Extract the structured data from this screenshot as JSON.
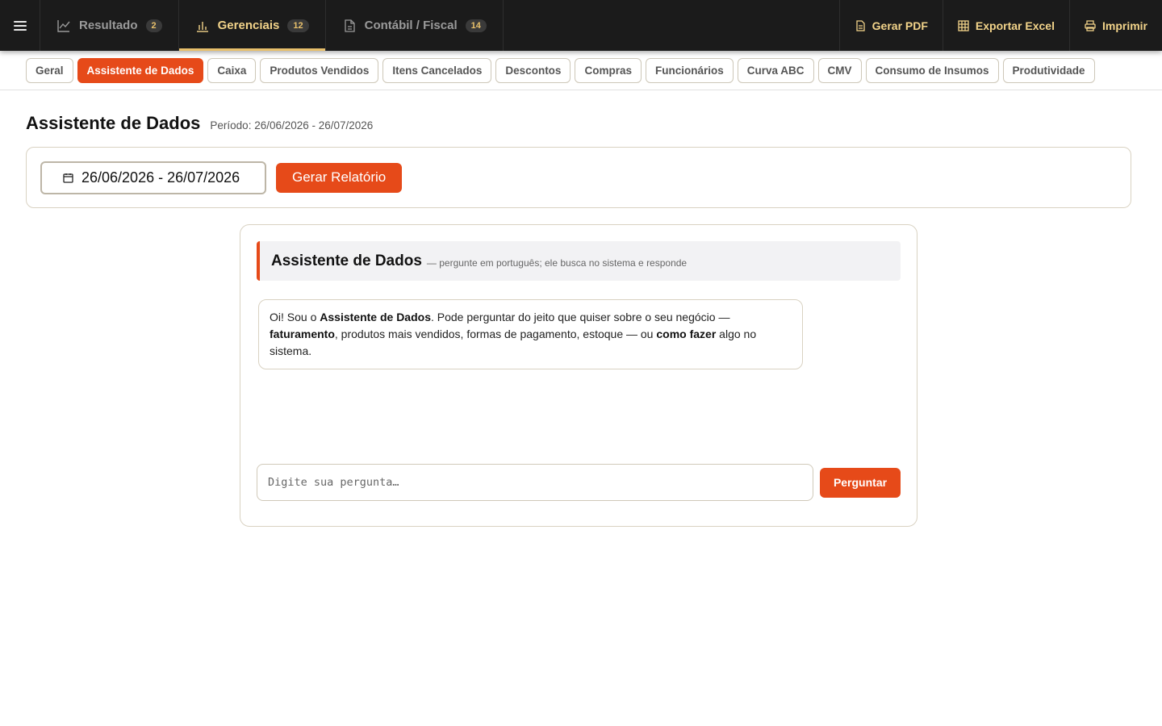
{
  "topbar": {
    "tabs": [
      {
        "label": "Resultado",
        "badge": "2"
      },
      {
        "label": "Gerenciais",
        "badge": "12"
      },
      {
        "label": "Contábil / Fiscal",
        "badge": "14"
      }
    ],
    "active_tab": "Gerenciais",
    "actions": {
      "pdf": "Gerar PDF",
      "excel": "Exportar Excel",
      "print": "Imprimir"
    }
  },
  "subtabs": [
    "Geral",
    "Assistente de Dados",
    "Caixa",
    "Produtos Vendidos",
    "Itens Cancelados",
    "Descontos",
    "Compras",
    "Funcionários",
    "Curva ABC",
    "CMV",
    "Consumo de Insumos",
    "Produtividade"
  ],
  "active_subtab": "Assistente de Dados",
  "page": {
    "title": "Assistente de Dados",
    "period": "Período: 26/06/2026 - 26/07/2026"
  },
  "filter": {
    "date_range": "26/06/2026 - 26/07/2026",
    "generate_label": "Gerar Relatório"
  },
  "assistant": {
    "title": "Assistente de Dados",
    "subtitle": "— pergunte em português; ele busca no sistema e responde",
    "greeting": {
      "p1": "Oi! Sou o ",
      "b1": "Assistente de Dados",
      "p2": ". Pode perguntar do jeito que quiser sobre o seu negócio — ",
      "b2": "faturamento",
      "p3": ", produtos mais vendidos, formas de pagamento, estoque — ou ",
      "b3": "como fazer",
      "p4": " algo no sistema."
    },
    "input_placeholder": "Digite sua pergunta…",
    "ask_label": "Perguntar"
  },
  "colors": {
    "accent": "#e64a19",
    "topbar_bg": "#1b1b1b",
    "topbar_active": "#f3d48a"
  }
}
